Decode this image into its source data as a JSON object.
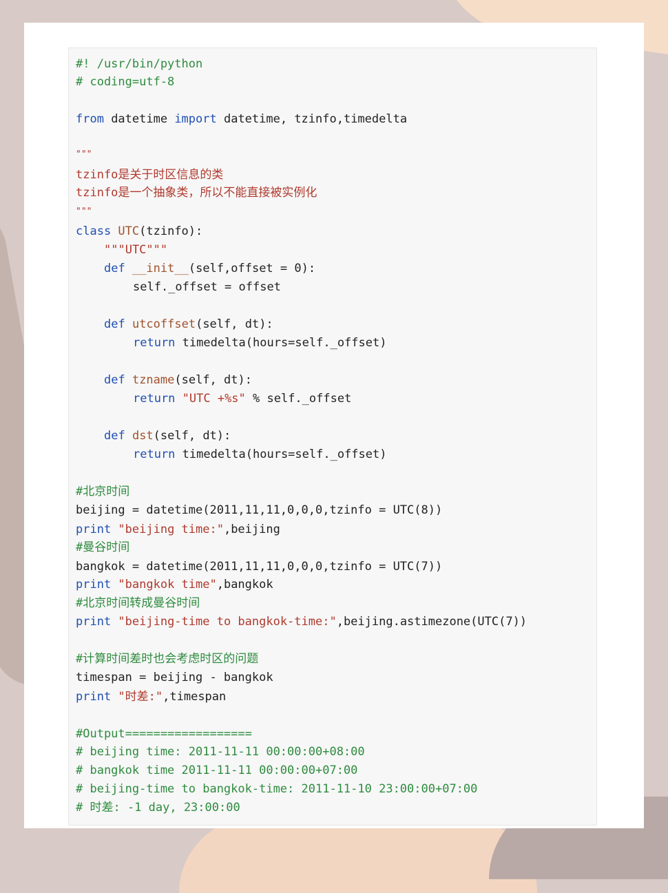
{
  "colors": {
    "comment": "#2e8b3e",
    "string": "#b03a2e",
    "keyword": "#1f4fb3",
    "name": "#a0522d",
    "text": "#222222",
    "code_bg": "#f7f7f7"
  },
  "code": {
    "shebang": "#! /usr/bin/python",
    "coding": "# coding=utf-8",
    "import_kw_from": "from",
    "import_mid": " datetime ",
    "import_kw_import": "import",
    "import_rest": " datetime, tzinfo,timedelta",
    "docq_open": "\"\"\"",
    "doc_line1": "tzinfo是关于时区信息的类",
    "doc_line2": "tzinfo是一个抽象类，所以不能直接被实例化",
    "docq_close": "\"\"\"",
    "class_kw": "class",
    "class_name": " UTC",
    "class_rest": "(tzinfo):",
    "class_doc": "\"\"\"UTC\"\"\"",
    "def_kw": "def",
    "init_name": " __init__",
    "init_rest": "(self,offset = 0):",
    "init_body": "self._offset = offset",
    "utc_name": " utcoffset",
    "utc_rest": "(self, dt):",
    "return_kw": "return",
    "utc_body": " timedelta(hours=self._offset)",
    "tz_name": " tzname",
    "tz_rest": "(self, dt):",
    "tz_str": " \"UTC +%s\"",
    "tz_body": " % self._offset",
    "dst_name": " dst",
    "dst_rest": "(self, dt):",
    "dst_body": " timedelta(hours=self._offset)",
    "cmt_beijing": "#北京时间",
    "beijing_assign": "beijing = datetime(2011,11,11,0,0,0,tzinfo = UTC(8))",
    "print_kw": "print",
    "print1_str": " \"beijing time:\"",
    "print1_rest": ",beijing",
    "cmt_bangkok": "#曼谷时间",
    "bangkok_assign": "bangkok = datetime(2011,11,11,0,0,0,tzinfo = UTC(7))",
    "print2_str": " \"bangkok time\"",
    "print2_rest": ",bangkok",
    "cmt_convert": "#北京时间转成曼谷时间",
    "print3_str": " \"beijing-time to bangkok-time:\"",
    "print3_rest": ",beijing.astimezone(UTC(7))",
    "cmt_diff": "#计算时间差时也会考虑时区的问题",
    "timespan_assign": "timespan = beijing - bangkok",
    "print4_str": " \"时差:\"",
    "print4_rest": ",timespan",
    "output_header": "#Output==================",
    "out1": "# beijing time: 2011-11-11 00:00:00+08:00",
    "out2": "# bangkok time 2011-11-11 00:00:00+07:00",
    "out3": "# beijing-time to bangkok-time: 2011-11-10 23:00:00+07:00",
    "out4": "# 时差: -1 day, 23:00:00"
  }
}
